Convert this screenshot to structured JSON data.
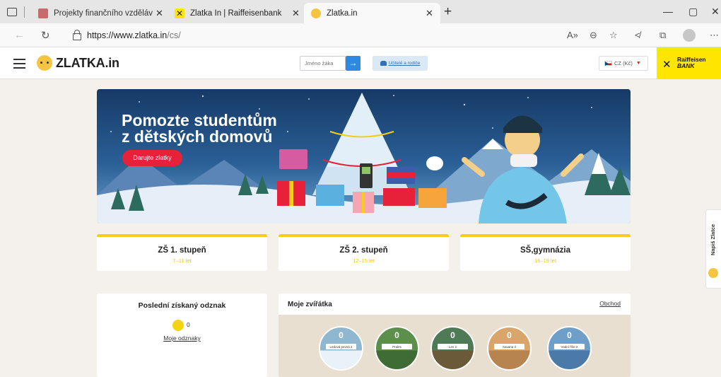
{
  "browser": {
    "tabs": [
      {
        "label": "Projekty finančního vzdělávání | ř"
      },
      {
        "label": "Zlatka In | Raiffeisenbank"
      },
      {
        "label": "Zlatka.in"
      }
    ],
    "url_main": "https://www.zlatka.in",
    "url_path": "/cs/"
  },
  "header": {
    "logo": "ZLATKA.in",
    "student_placeholder": "Jméno žáka",
    "teachers_label": "Učitelé a rodiče",
    "language_label": "CZ (Kč)",
    "bank_line1": "Raiffeisen",
    "bank_line2": "BANK"
  },
  "banner": {
    "title_line1": "Pomozte studentům",
    "title_line2": "z dětských domovů",
    "button": "Darujte zlatky"
  },
  "age_groups": [
    {
      "title": "ZŠ 1. stupeň",
      "ages": "7–11 let"
    },
    {
      "title": "ZŠ 2. stupeň",
      "ages": "12–15 let"
    },
    {
      "title": "SŠ,gymnázia",
      "ages": "16–19 let"
    }
  ],
  "badges": {
    "title": "Poslední získaný odznak",
    "count": "0",
    "link": "Moje odznaky"
  },
  "animals": {
    "title": "Moje zvířátka",
    "shop": "Obchod",
    "items": [
      {
        "count": "0",
        "label": "Ledová pevná 2"
      },
      {
        "count": "0",
        "label": "Prales"
      },
      {
        "count": "0",
        "label": "Les 2"
      },
      {
        "count": "0",
        "label": "Savana 2"
      },
      {
        "count": "0",
        "label": "Vodní říše 2"
      }
    ]
  },
  "sidetab": {
    "label": "Napiš Zlatce"
  },
  "colors": {
    "accent_yellow": "#f5cc17",
    "button_blue": "#2d8ae0",
    "donate_red": "#e8213b",
    "page_bg": "#f4f0ec"
  }
}
